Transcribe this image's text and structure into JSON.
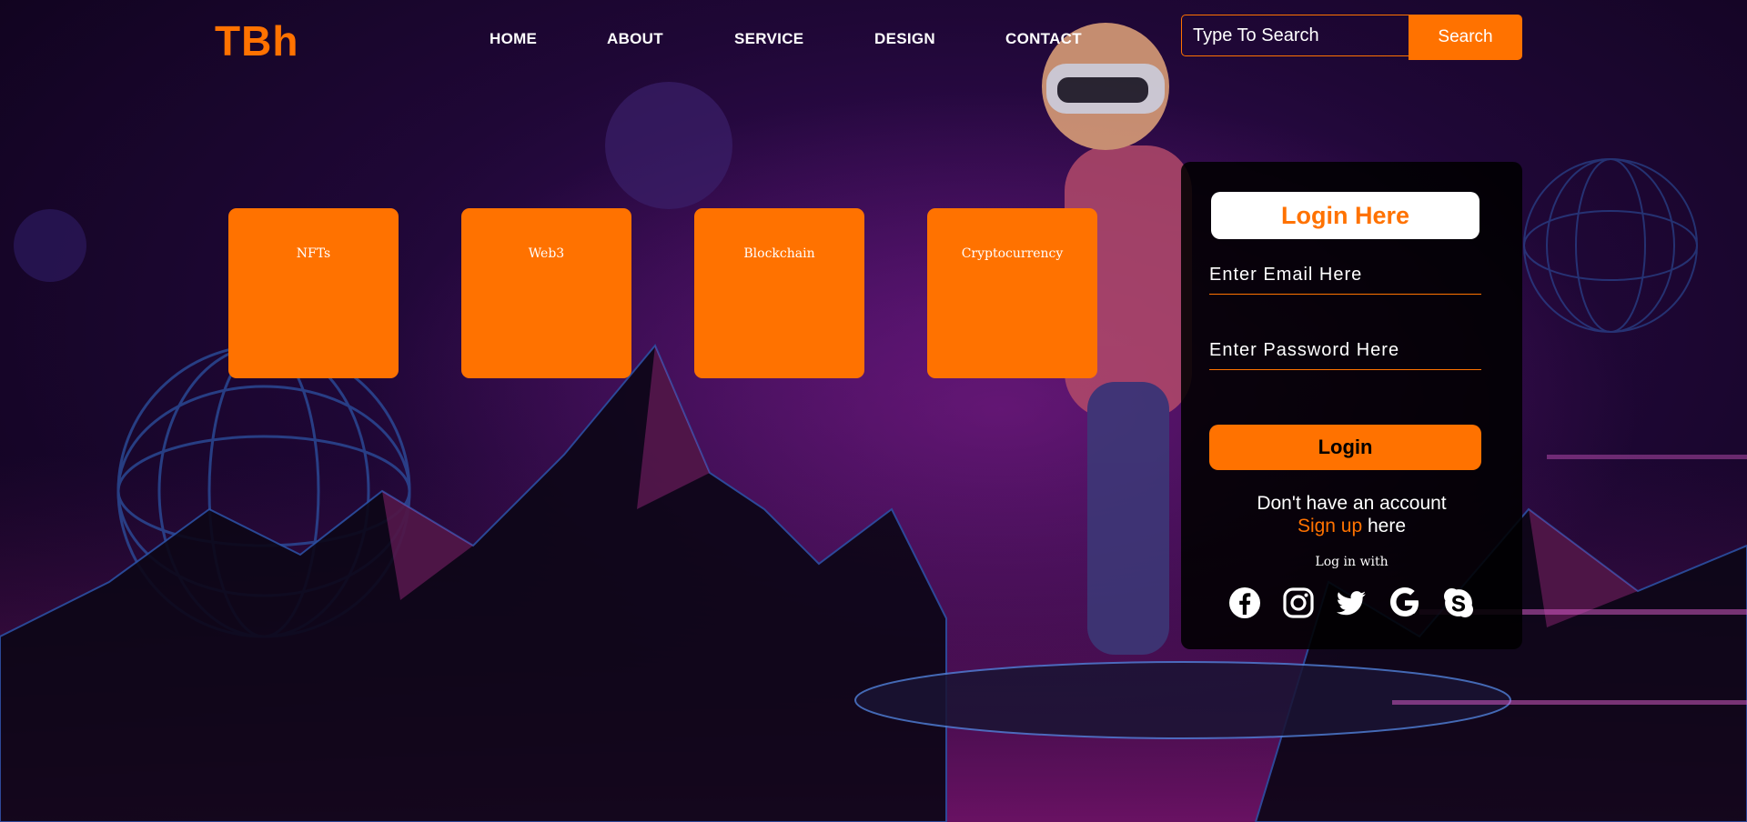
{
  "brand": {
    "logo": "TBh",
    "accent": "#ff7200"
  },
  "nav": {
    "items": [
      {
        "label": "HOME"
      },
      {
        "label": "ABOUT"
      },
      {
        "label": "SERVICE"
      },
      {
        "label": "DESIGN"
      },
      {
        "label": "CONTACT"
      }
    ]
  },
  "search": {
    "placeholder": "Type To Search",
    "button_label": "Search"
  },
  "cards": [
    {
      "label": "NFTs"
    },
    {
      "label": "Web3"
    },
    {
      "label": "Blockchain"
    },
    {
      "label": "Cryptocurrency"
    }
  ],
  "login": {
    "title": "Login Here",
    "email_placeholder": "Enter Email Here",
    "password_placeholder": "Enter Password Here",
    "button_label": "Login",
    "no_account_text": "Don't have an account",
    "signup_link": "Sign up",
    "signup_suffix": " here",
    "log_in_with": "Log in with",
    "socials": [
      "facebook-icon",
      "instagram-icon",
      "twitter-icon",
      "google-icon",
      "skype-icon"
    ]
  }
}
